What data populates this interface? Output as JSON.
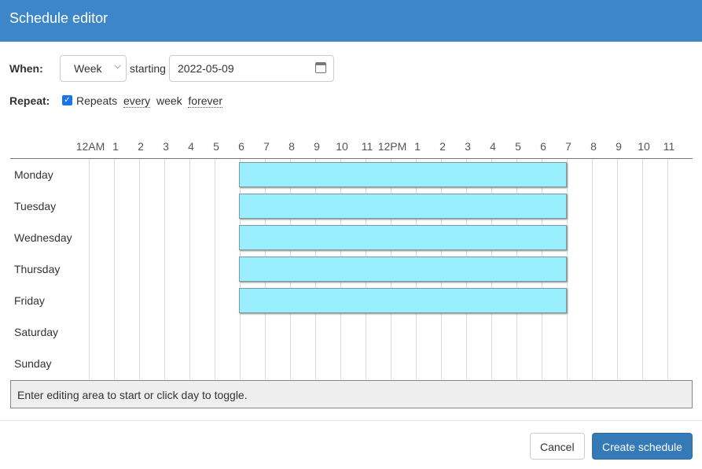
{
  "title": "Schedule editor",
  "when": {
    "label": "When:",
    "period": "Week",
    "starting_label": "starting",
    "date": "2022-05-09"
  },
  "repeat": {
    "label": "Repeat:",
    "checked": true,
    "text": "Repeats",
    "every": "every",
    "unit": "week",
    "duration": "forever"
  },
  "hours": [
    "12AM",
    "1",
    "2",
    "3",
    "4",
    "5",
    "6",
    "7",
    "8",
    "9",
    "10",
    "11",
    "12PM",
    "1",
    "2",
    "3",
    "4",
    "5",
    "6",
    "7",
    "8",
    "9",
    "10",
    "11"
  ],
  "days": [
    "Monday",
    "Tuesday",
    "Wednesday",
    "Thursday",
    "Friday",
    "Saturday",
    "Sunday"
  ],
  "blocks": [
    {
      "day": "Monday",
      "start": 6,
      "end": 19
    },
    {
      "day": "Tuesday",
      "start": 6,
      "end": 19
    },
    {
      "day": "Wednesday",
      "start": 6,
      "end": 19
    },
    {
      "day": "Thursday",
      "start": 6,
      "end": 19
    },
    {
      "day": "Friday",
      "start": 6,
      "end": 19
    }
  ],
  "status": "Enter editing area to start or click day to toggle.",
  "buttons": {
    "cancel": "Cancel",
    "create": "Create schedule"
  },
  "colors": {
    "header": "#3d87c8",
    "block": "#9aefff",
    "primary": "#337ab7"
  }
}
